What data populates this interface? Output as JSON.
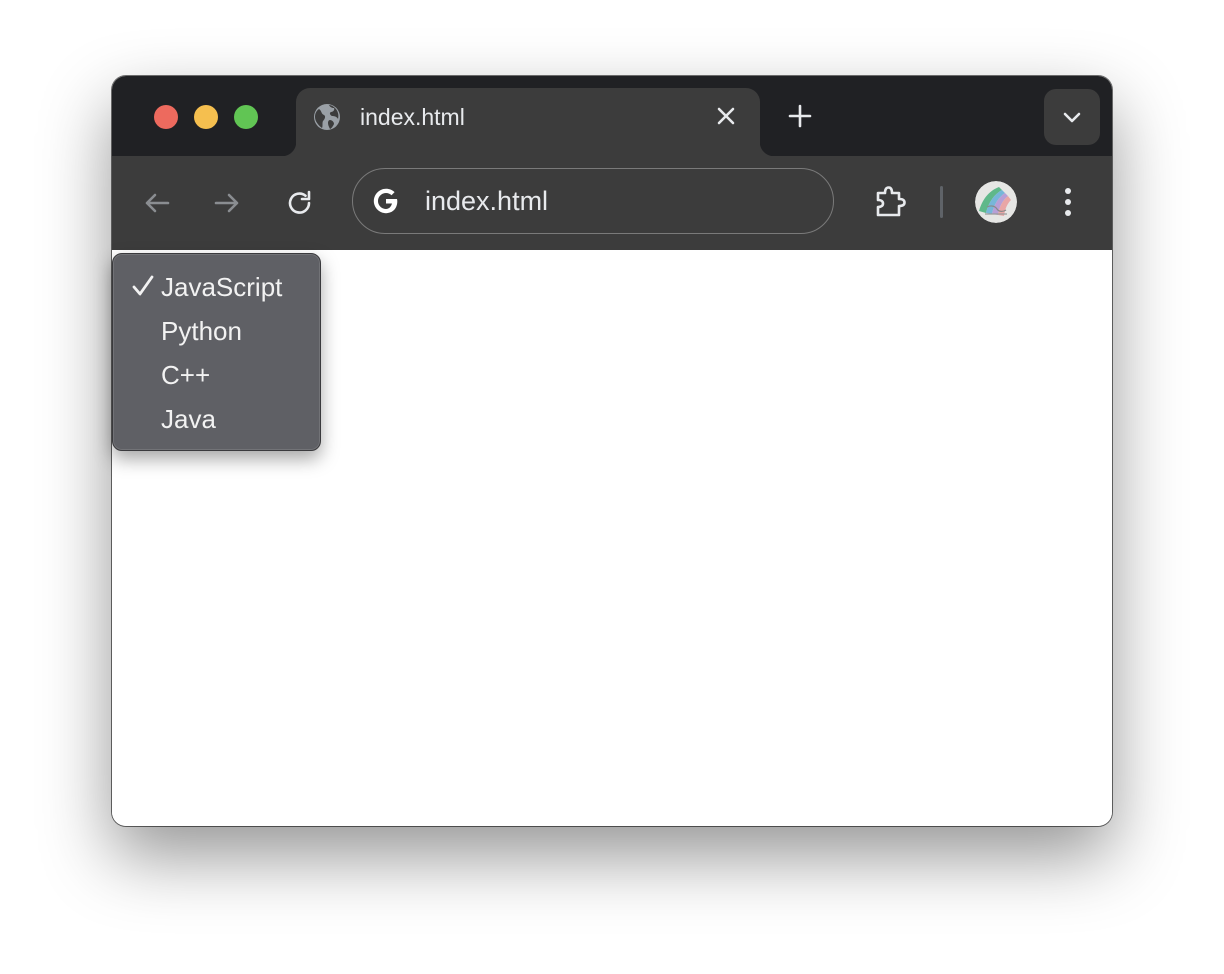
{
  "browser": {
    "tab": {
      "title": "index.html",
      "icon": "globe-icon"
    },
    "new_tab_icon": "plus-icon",
    "tab_search_icon": "chevron-down-icon",
    "toolbar": {
      "back_icon": "arrow-left-icon",
      "forward_icon": "arrow-right-icon",
      "reload_icon": "reload-icon",
      "extensions_icon": "puzzle-icon",
      "menu_icon": "more-vertical-icon"
    },
    "omnibox": {
      "url": "index.html",
      "icon": "google-g-icon"
    }
  },
  "dropdown": {
    "options": [
      {
        "label": "JavaScript",
        "selected": true
      },
      {
        "label": "Python",
        "selected": false
      },
      {
        "label": "C++",
        "selected": false
      },
      {
        "label": "Java",
        "selected": false
      }
    ]
  },
  "colors": {
    "titlebar": "#202124",
    "toolbar": "#3c3c3c",
    "dropdown_bg": "#5f6065",
    "traffic_red": "#ed6a5e",
    "traffic_yellow": "#f5bf4f",
    "traffic_green": "#61c554"
  }
}
